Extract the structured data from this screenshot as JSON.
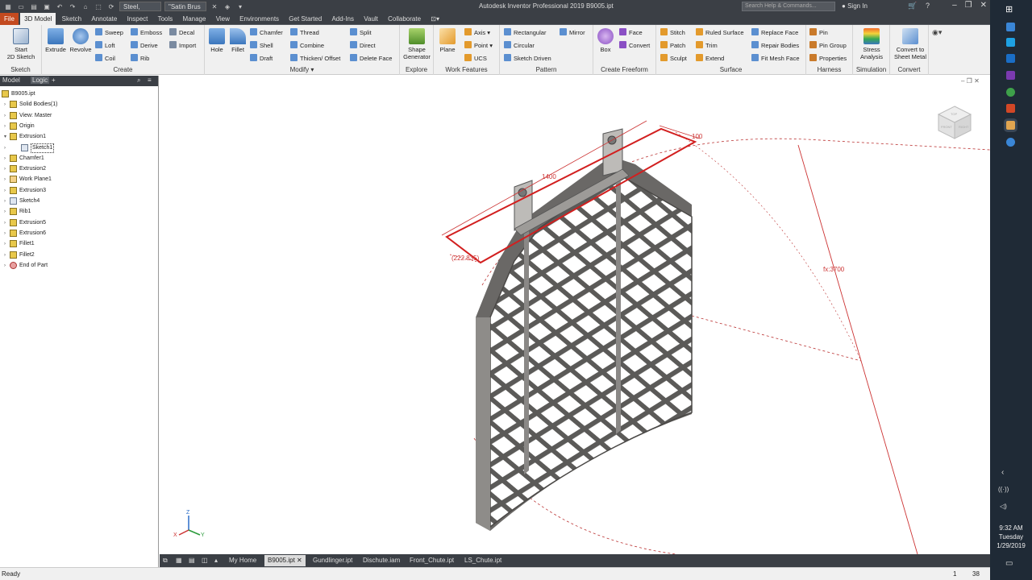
{
  "app": {
    "window_title": "Autodesk Inventor Professional 2019   B9005.ipt",
    "material": "Steel, Carbon",
    "appearance": "\"Satin Brus",
    "search_placeholder": "Search Help & Commands...",
    "signin": "Sign In"
  },
  "tabs": [
    "File",
    "3D Model",
    "Sketch",
    "Annotate",
    "Inspect",
    "Tools",
    "Manage",
    "View",
    "Environments",
    "Get Started",
    "Add-Ins",
    "Vault",
    "Collaborate"
  ],
  "ribbon": {
    "sketch_group": {
      "label": "Sketch",
      "start_sketch": "Start\n2D Sketch"
    },
    "create_group": {
      "label": "Create",
      "extrude": "Extrude",
      "revolve": "Revolve",
      "sweep": "Sweep",
      "loft": "Loft",
      "coil": "Coil",
      "emboss": "Emboss",
      "derive": "Derive",
      "rib": "Rib",
      "decal": "Decal",
      "import": "Import"
    },
    "modify_group": {
      "label": "Modify",
      "hole": "Hole",
      "fillet": "Fillet",
      "chamfer": "Chamfer",
      "shell": "Shell",
      "draft": "Draft",
      "thread": "Thread",
      "combine": "Combine",
      "thicken": "Thicken/ Offset",
      "split": "Split",
      "direct": "Direct",
      "delete_face": "Delete Face"
    },
    "explore_group": {
      "label": "Explore",
      "shape_generator": "Shape\nGenerator"
    },
    "work_features_group": {
      "label": "Work Features",
      "plane": "Plane",
      "axis": "Axis",
      "point": "Point",
      "ucs": "UCS"
    },
    "pattern_group": {
      "label": "Pattern",
      "rectangular": "Rectangular",
      "circular": "Circular",
      "sketch_driven": "Sketch Driven",
      "mirror": "Mirror"
    },
    "freeform_group": {
      "label": "Create Freeform",
      "box": "Box",
      "face": "Face",
      "convert": "Convert"
    },
    "surface_group": {
      "label": "Surface",
      "stitch": "Stitch",
      "patch": "Patch",
      "sculpt": "Sculpt",
      "ruled_surface": "Ruled Surface",
      "trim": "Trim",
      "extend": "Extend",
      "replace_face": "Replace Face",
      "repair_bodies": "Repair Bodies",
      "fit_mesh_face": "Fit Mesh Face"
    },
    "harness_group": {
      "label": "Harness",
      "pin": "Pin",
      "pin_group": "Pin Group",
      "properties": "Properties"
    },
    "simulation_group": {
      "label": "Simulation",
      "stress": "Stress\nAnalysis"
    },
    "convert_group": {
      "label": "Convert",
      "to_sheet_metal": "Convert to\nSheet Metal"
    }
  },
  "browser": {
    "tab_model": "Model",
    "tab_logic": "Logic",
    "tree": [
      {
        "label": "B9005.ipt",
        "level": 0
      },
      {
        "label": "Solid Bodies(1)",
        "level": 1
      },
      {
        "label": "View: Master",
        "level": 1
      },
      {
        "label": "Origin",
        "level": 1
      },
      {
        "label": "Extrusion1",
        "level": 1,
        "expanded": true
      },
      {
        "label": "Sketch1",
        "level": 2,
        "selected": true
      },
      {
        "label": "Chamfer1",
        "level": 1
      },
      {
        "label": "Extrusion2",
        "level": 1
      },
      {
        "label": "Work Plane1",
        "level": 1
      },
      {
        "label": "Extrusion3",
        "level": 1
      },
      {
        "label": "Sketch4",
        "level": 1
      },
      {
        "label": "Rib1",
        "level": 1
      },
      {
        "label": "Extrusion5",
        "level": 1
      },
      {
        "label": "Extrusion6",
        "level": 1
      },
      {
        "label": "Fillet1",
        "level": 1
      },
      {
        "label": "Fillet2",
        "level": 1
      },
      {
        "label": "End of Part",
        "level": 1
      }
    ]
  },
  "viewport": {
    "dim_length": "1400",
    "dim_width": "100",
    "dim_ref": "(222.835)",
    "dim_radius": "fx:3700",
    "viewcube_labels": [
      "TOP",
      "FRONT",
      "RIGHT"
    ],
    "triad_labels": [
      "Z",
      "X",
      "Y"
    ]
  },
  "document_tabs": [
    "My Home",
    "B9005.ipt",
    "Gundlinger.ipt",
    "Dischute.iam",
    "Front_Chute.ipt",
    "LS_Chute.ipt"
  ],
  "status": {
    "text": "Ready",
    "count1": "1",
    "count2": "38"
  },
  "clock": {
    "time": "9:32 AM",
    "day": "Tuesday",
    "date": "1/29/2019"
  },
  "colors": {
    "dim_red": "#cc2222",
    "file_tab": "#c34a1f",
    "chrome": "#3b3f45"
  }
}
